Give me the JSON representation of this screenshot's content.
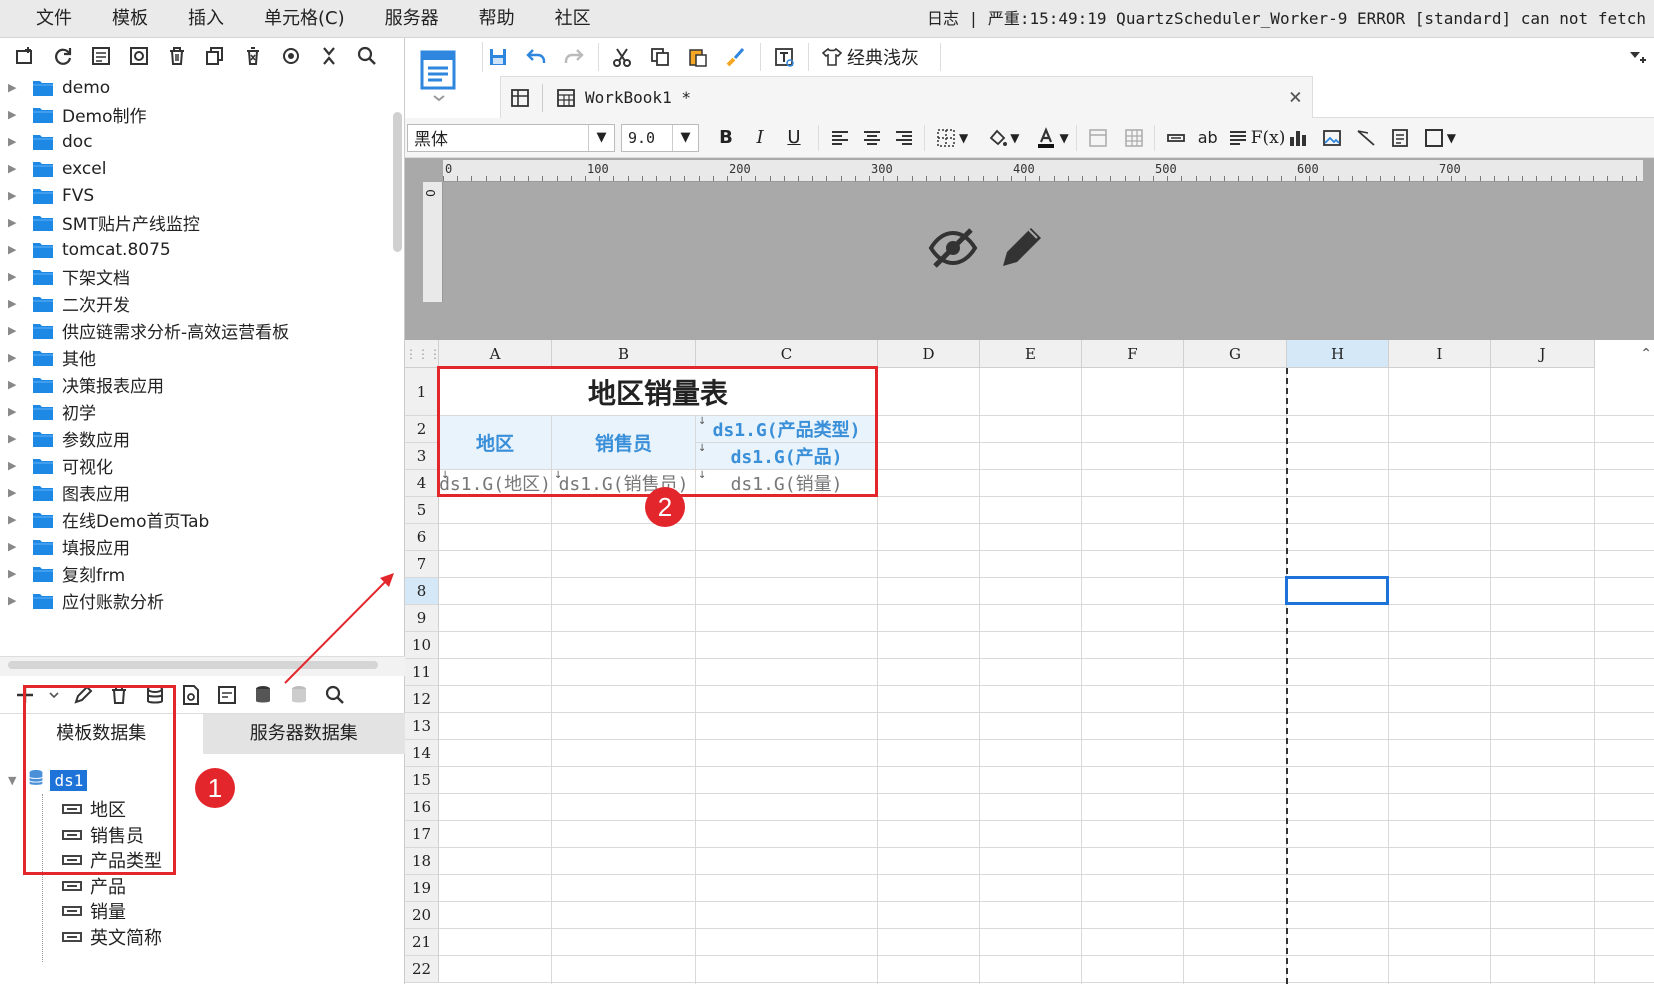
{
  "menu": [
    "文件",
    "模板",
    "插入",
    "单元格(C)",
    "服务器",
    "帮助",
    "社区"
  ],
  "log": {
    "text": "日志 | 严重:15:49:19 QuartzScheduler_Worker-9 ERROR [standard] can not fetch"
  },
  "left_toolbar_icons": [
    "new-folder-icon",
    "refresh-icon",
    "property-icon",
    "cell-settings-icon",
    "delete-icon",
    "copy-icon",
    "clear-icon",
    "locate-icon",
    "collapse-icon",
    "search-icon"
  ],
  "tree": {
    "folders": [
      "demo",
      "Demo制作",
      "doc",
      "excel",
      "FVS",
      "SMT贴片产线监控",
      "tomcat.8075",
      "下架文档",
      "二次开发",
      "供应链需求分析-高效运营看板",
      "其他",
      "决策报表应用",
      "初学",
      "参数应用",
      "可视化",
      "图表应用",
      "在线Demo首页Tab",
      "填报应用",
      "复刻frm",
      "应付账款分析"
    ]
  },
  "dataset_tabs": {
    "template": "模板数据集",
    "server": "服务器数据集"
  },
  "dataset": {
    "name": "ds1",
    "fields": [
      "地区",
      "销售员",
      "产品类型",
      "产品",
      "销量",
      "英文简称"
    ]
  },
  "badges": {
    "one": "1",
    "two": "2"
  },
  "toolbar": {
    "theme_label": "经典浅灰"
  },
  "workbook": {
    "tab_label": "WorkBook1 *",
    "close": "×"
  },
  "format": {
    "font": "黑体",
    "size": "9.0",
    "bold": "B",
    "italic": "I",
    "underline": "U",
    "ab": "ab",
    "fx": "F(x)"
  },
  "ruler_labels": [
    "0",
    "100",
    "200",
    "300",
    "400",
    "500",
    "600",
    "700"
  ],
  "vruler_label": "0",
  "columns": [
    "A",
    "B",
    "C",
    "D",
    "E",
    "F",
    "G",
    "H",
    "I",
    "J"
  ],
  "rows": [
    "1",
    "2",
    "3",
    "4",
    "5",
    "6",
    "7",
    "8",
    "9",
    "10",
    "11",
    "12",
    "13",
    "14",
    "15",
    "16",
    "17",
    "18",
    "19",
    "20",
    "21",
    "22"
  ],
  "sheet": {
    "title": "地区销量表",
    "header_region": "地区",
    "header_salesman": "销售员",
    "ds_product_type": "ds1.G(产品类型)",
    "ds_product": "ds1.G(产品)",
    "d_region": "ds1.G(地区)",
    "d_salesman": "ds1.G(销售员)",
    "d_sales": "ds1.G(销量)"
  },
  "colors": {
    "accent": "#1e73d8",
    "annotation": "#e3262b",
    "header_text": "#3a8fd9"
  }
}
